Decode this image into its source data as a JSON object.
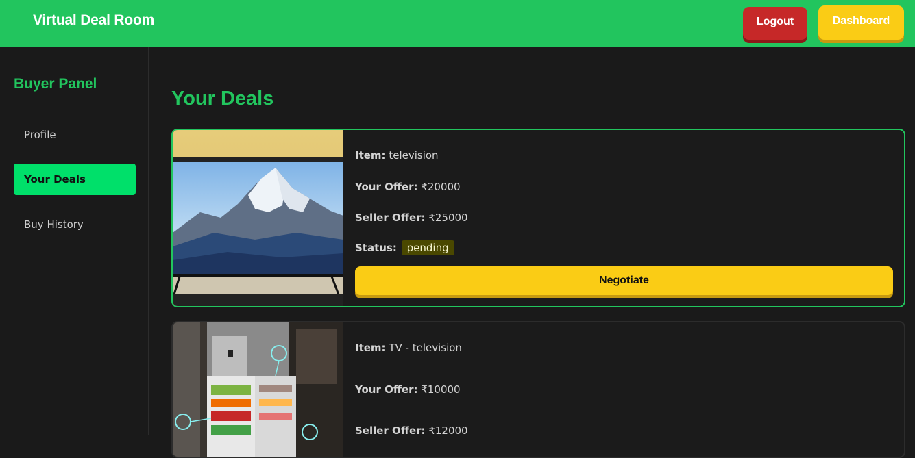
{
  "header": {
    "brand": "Virtual Deal Room",
    "logout_label": "Logout",
    "dashboard_label": "Dashboard"
  },
  "sidebar": {
    "title": "Buyer Panel",
    "items": [
      {
        "label": "Profile",
        "active": false
      },
      {
        "label": "Your Deals",
        "active": true
      },
      {
        "label": "Buy History",
        "active": false
      }
    ]
  },
  "main": {
    "title": "Your Deals",
    "labels": {
      "item": "Item:",
      "your_offer": "Your Offer:",
      "seller_offer": "Seller Offer:",
      "status": "Status:"
    },
    "deals": [
      {
        "item": "television",
        "your_offer": "₹20000",
        "seller_offer": "₹25000",
        "status": "pending",
        "negotiate_label": "Negotiate",
        "image": "television-photo"
      },
      {
        "item": "TV - television",
        "your_offer": "₹10000",
        "seller_offer": "₹12000",
        "image": "refrigerator-photo"
      }
    ]
  },
  "colors": {
    "brand_green": "#22c55e",
    "active_nav": "#00e06a",
    "logout_red": "#c62828",
    "accent_yellow": "#facc15",
    "background": "#1a1a1a"
  }
}
